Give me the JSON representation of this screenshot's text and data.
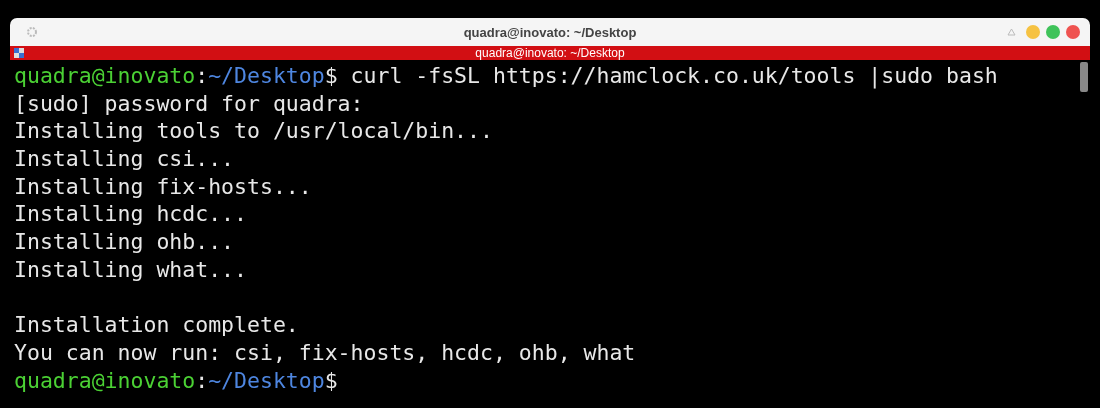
{
  "window": {
    "title": "quadra@inovato: ~/Desktop"
  },
  "tab_bar": {
    "title": "quadra@inovato: ~/Desktop"
  },
  "terminal": {
    "lines": [
      {
        "kind": "prompt",
        "user": "quadra@inovato",
        "sep": ":",
        "path": "~/Desktop",
        "symbol": "$",
        "command": " curl -fsSL https://hamclock.co.uk/tools |sudo bash"
      },
      {
        "kind": "output",
        "text": "[sudo] password for quadra:"
      },
      {
        "kind": "output",
        "text": "Installing tools to /usr/local/bin..."
      },
      {
        "kind": "output",
        "text": "Installing csi..."
      },
      {
        "kind": "output",
        "text": "Installing fix-hosts..."
      },
      {
        "kind": "output",
        "text": "Installing hcdc..."
      },
      {
        "kind": "output",
        "text": "Installing ohb..."
      },
      {
        "kind": "output",
        "text": "Installing what..."
      },
      {
        "kind": "blank"
      },
      {
        "kind": "output",
        "text": "Installation complete."
      },
      {
        "kind": "output",
        "text": "You can now run: csi, fix-hosts, hcdc, ohb, what"
      },
      {
        "kind": "prompt",
        "user": "quadra@inovato",
        "sep": ":",
        "path": "~/Desktop",
        "symbol": "$"
      }
    ]
  }
}
